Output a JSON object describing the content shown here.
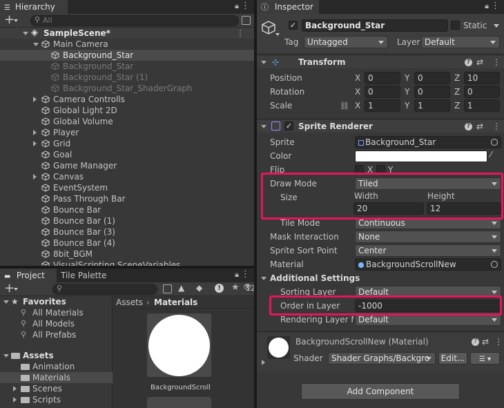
{
  "hierarchy": {
    "tab_label": "Hierarchy",
    "search_placeholder": "All",
    "scene_name": "SampleScene*",
    "items": [
      {
        "label": "Main Camera",
        "indent": 1,
        "fold": "open",
        "state": "normal"
      },
      {
        "label": "Background_Star",
        "indent": 2,
        "fold": "none",
        "state": "selected"
      },
      {
        "label": "Background_Star",
        "indent": 2,
        "fold": "none",
        "state": "disabled"
      },
      {
        "label": "Background_Star (1)",
        "indent": 2,
        "fold": "none",
        "state": "disabled"
      },
      {
        "label": "Background_Star_ShaderGraph",
        "indent": 2,
        "fold": "none",
        "state": "disabled"
      },
      {
        "label": "Camera Controlls",
        "indent": 1,
        "fold": "closed",
        "state": "normal"
      },
      {
        "label": "Global Light 2D",
        "indent": 1,
        "fold": "none",
        "state": "normal"
      },
      {
        "label": "Global Volume",
        "indent": 1,
        "fold": "none",
        "state": "normal"
      },
      {
        "label": "Player",
        "indent": 1,
        "fold": "closed",
        "state": "normal"
      },
      {
        "label": "Grid",
        "indent": 1,
        "fold": "closed",
        "state": "normal"
      },
      {
        "label": "Goal",
        "indent": 1,
        "fold": "none",
        "state": "normal"
      },
      {
        "label": "Game Manager",
        "indent": 1,
        "fold": "none",
        "state": "normal"
      },
      {
        "label": "Canvas",
        "indent": 1,
        "fold": "closed",
        "state": "normal"
      },
      {
        "label": "EventSystem",
        "indent": 1,
        "fold": "none",
        "state": "normal"
      },
      {
        "label": "Pass Through Bar",
        "indent": 1,
        "fold": "none",
        "state": "normal"
      },
      {
        "label": "Bounce Bar",
        "indent": 1,
        "fold": "none",
        "state": "normal"
      },
      {
        "label": "Bounce Bar (1)",
        "indent": 1,
        "fold": "none",
        "state": "normal"
      },
      {
        "label": "Bounce Bar (3)",
        "indent": 1,
        "fold": "none",
        "state": "normal"
      },
      {
        "label": "Bounce Bar (4)",
        "indent": 1,
        "fold": "none",
        "state": "normal"
      },
      {
        "label": "8bit_BGM",
        "indent": 1,
        "fold": "none",
        "state": "normal"
      },
      {
        "label": "VisualScripting SceneVariables",
        "indent": 1,
        "fold": "none",
        "state": "normal"
      }
    ]
  },
  "project": {
    "tab_label": "Project",
    "tab2_label": "Tile Palette",
    "hidden_count": "12",
    "favorites_label": "Favorites",
    "favorites": [
      "All Materials",
      "All Models",
      "All Prefabs"
    ],
    "assets_label": "Assets",
    "folders": [
      {
        "label": "Animation",
        "fold": false,
        "selected": false
      },
      {
        "label": "Materials",
        "fold": false,
        "selected": true
      },
      {
        "label": "Scenes",
        "fold": true,
        "selected": false
      },
      {
        "label": "Scripts",
        "fold": true,
        "selected": false
      }
    ],
    "breadcrumb_root": "Assets",
    "breadcrumb_current": "Materials",
    "asset_name": "BackgroundScroll"
  },
  "inspector": {
    "tab_label": "Inspector",
    "object_name": "Background_Star",
    "static_label": "Static",
    "tag_label": "Tag",
    "tag_value": "Untagged",
    "layer_label": "Layer",
    "layer_value": "Default",
    "transform": {
      "title": "Transform",
      "position_label": "Position",
      "rotation_label": "Rotation",
      "scale_label": "Scale",
      "position": [
        "0",
        "0",
        "10"
      ],
      "rotation": [
        "0",
        "0",
        "0"
      ],
      "scale": [
        "1",
        "1",
        "1"
      ],
      "axis_labels": [
        "X",
        "Y",
        "Z"
      ]
    },
    "sprite_renderer": {
      "title": "Sprite Renderer",
      "sprite_label": "Sprite",
      "sprite_value": "Background_Star",
      "color_label": "Color",
      "color_value": "#ffffff",
      "flip_label": "Flip",
      "flip_x": "X",
      "flip_y": "Y",
      "draw_mode_label": "Draw Mode",
      "draw_mode_value": "Tiled",
      "size_label": "Size",
      "width_label": "Width",
      "height_label": "Height",
      "width_value": "20",
      "height_value": "12",
      "tile_mode_label": "Tile Mode",
      "tile_mode_value": "Continuous",
      "mask_label": "Mask Interaction",
      "mask_value": "None",
      "sort_point_label": "Sprite Sort Point",
      "sort_point_value": "Center",
      "material_label": "Material",
      "material_value": "BackgroundScrollNew",
      "additional_label": "Additional Settings",
      "sorting_layer_label": "Sorting Layer",
      "sorting_layer_value": "Default",
      "order_label": "Order in Layer",
      "order_value": "-1000",
      "rendering_layer_label": "Rendering Layer M",
      "rendering_layer_value": "Default"
    },
    "material": {
      "title": "BackgroundScrollNew (Material)",
      "shader_label": "Shader",
      "shader_value": "Shader Graphs/Backgro",
      "edit_label": "Edit..."
    },
    "add_component_label": "Add Component"
  },
  "colors": {
    "highlight": "#e8155a",
    "selection": "#4a4a4a",
    "panel_bg": "#383838"
  }
}
